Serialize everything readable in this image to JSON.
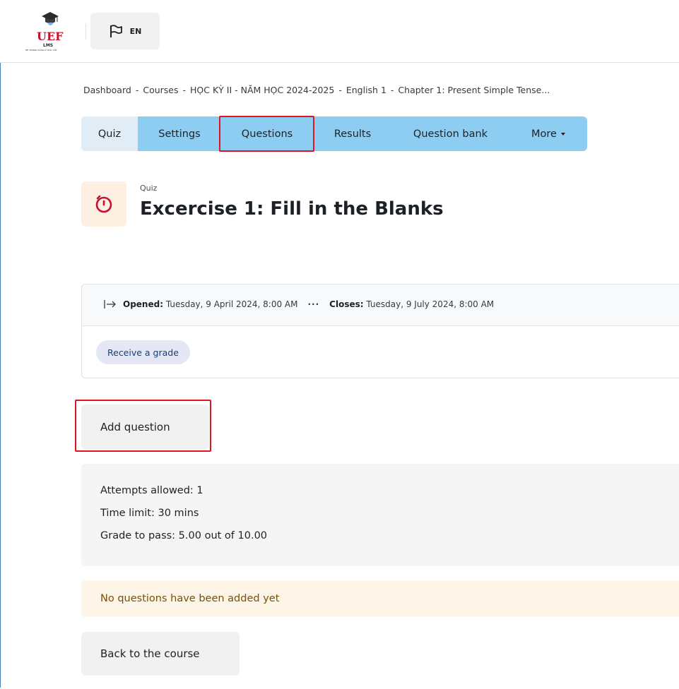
{
  "header": {
    "logo_text": "UEF",
    "logo_sub": "LMS",
    "logo_tagline": "HỆ THỐNG QUẢN LÝ HỌC TẬP",
    "language_label": "EN",
    "language_icon": "flag-icon"
  },
  "breadcrumb": {
    "items": [
      "Dashboard",
      "Courses",
      "HỌC KỲ II - NĂM HỌC 2024-2025",
      "English 1",
      "Chapter 1: Present Simple Tense..."
    ],
    "separator": "-"
  },
  "tabs": {
    "items": [
      "Quiz",
      "Settings",
      "Questions",
      "Results",
      "Question bank",
      "More"
    ],
    "active": "Quiz",
    "highlighted": "Questions"
  },
  "activity": {
    "icon": "stopwatch-icon",
    "type_label": "Quiz",
    "title": "Excercise 1: Fill in the Blanks"
  },
  "dates": {
    "opened_label": "Opened:",
    "opened_value": "Tuesday, 9 April 2024, 8:00 AM",
    "separator": "···",
    "closes_label": "Closes:",
    "closes_value": "Tuesday, 9 July 2024, 8:00 AM",
    "requirement": "Receive a grade"
  },
  "actions": {
    "add_question": "Add question",
    "back_to_course": "Back to the course"
  },
  "quiz_info": {
    "attempts": "Attempts allowed: 1",
    "time_limit": "Time limit: 30 mins",
    "grade_to_pass": "Grade to pass: 5.00 out of 10.00"
  },
  "notice": {
    "text": "No questions have been added yet"
  },
  "colors": {
    "tab_bar": "#8ecdf2",
    "active_tab": "#e0edf7",
    "highlight": "#e0141e",
    "notice_bg": "#fcf5e8",
    "icon_accent": "#c8102e"
  }
}
